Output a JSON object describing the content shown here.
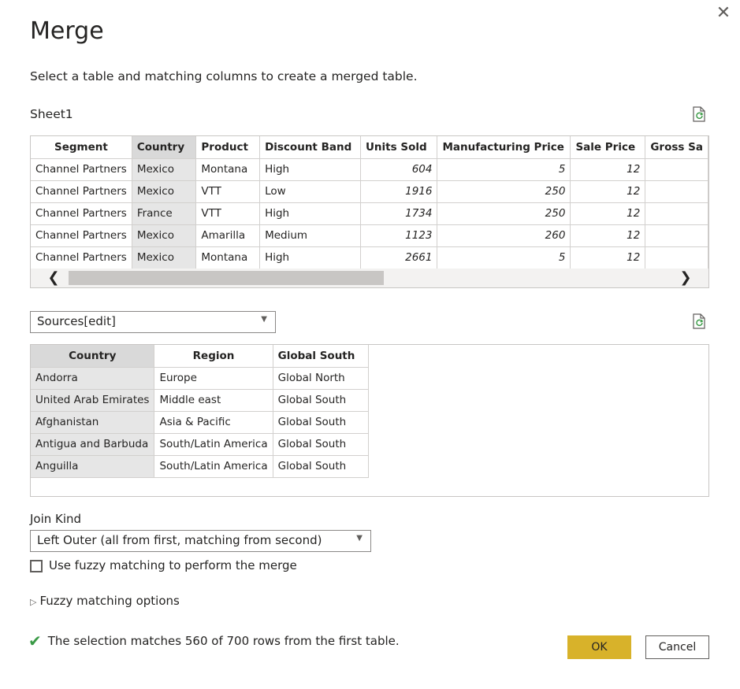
{
  "dialog": {
    "title": "Merge",
    "subtitle": "Select a table and matching columns to create a merged table.",
    "close_glyph": "✕"
  },
  "first_table": {
    "name": "Sheet1",
    "columns": [
      "Segment",
      "Country",
      "Product",
      "Discount Band",
      "Units Sold",
      "Manufacturing Price",
      "Sale Price",
      "Gross Sa"
    ],
    "rows": [
      [
        "Channel Partners",
        "Mexico",
        "Montana",
        "High",
        "604",
        "5",
        "12",
        ""
      ],
      [
        "Channel Partners",
        "Mexico",
        "VTT",
        "Low",
        "1916",
        "250",
        "12",
        ""
      ],
      [
        "Channel Partners",
        "France",
        "VTT",
        "High",
        "1734",
        "250",
        "12",
        ""
      ],
      [
        "Channel Partners",
        "Mexico",
        "Amarilla",
        "Medium",
        "1123",
        "260",
        "12",
        ""
      ],
      [
        "Channel Partners",
        "Mexico",
        "Montana",
        "High",
        "2661",
        "5",
        "12",
        ""
      ]
    ],
    "selected_column": "Country",
    "scroll_left": "❮",
    "scroll_right": "❯"
  },
  "second_table": {
    "selected": "Sources[edit]",
    "columns": [
      "Country",
      "Region",
      "Global South"
    ],
    "rows": [
      [
        "Andorra",
        "Europe",
        "Global North"
      ],
      [
        "United Arab Emirates",
        "Middle east",
        "Global South"
      ],
      [
        "Afghanistan",
        "Asia & Pacific",
        "Global South"
      ],
      [
        "Antigua and Barbuda",
        "South/Latin America",
        "Global South"
      ],
      [
        "Anguilla",
        "South/Latin America",
        "Global South"
      ]
    ],
    "selected_column": "Country"
  },
  "join": {
    "label": "Join Kind",
    "selected": "Left Outer (all from first, matching from second)",
    "fuzzy_checkbox_label": "Use fuzzy matching to perform the merge",
    "fuzzy_checked": false,
    "fuzzy_options_label": "Fuzzy matching options",
    "fuzzy_options_glyph": "▷"
  },
  "status": {
    "glyph": "✔",
    "text": "The selection matches 560 of 700 rows from the first table."
  },
  "buttons": {
    "ok": "OK",
    "cancel": "Cancel"
  },
  "colors": {
    "accent": "#d8b22a",
    "selected_column": "#e6e6e6",
    "check": "#3a9a46"
  },
  "icons": {
    "refresh": "refresh-document-icon",
    "close": "close-icon",
    "caret": "chevron-down-icon"
  }
}
